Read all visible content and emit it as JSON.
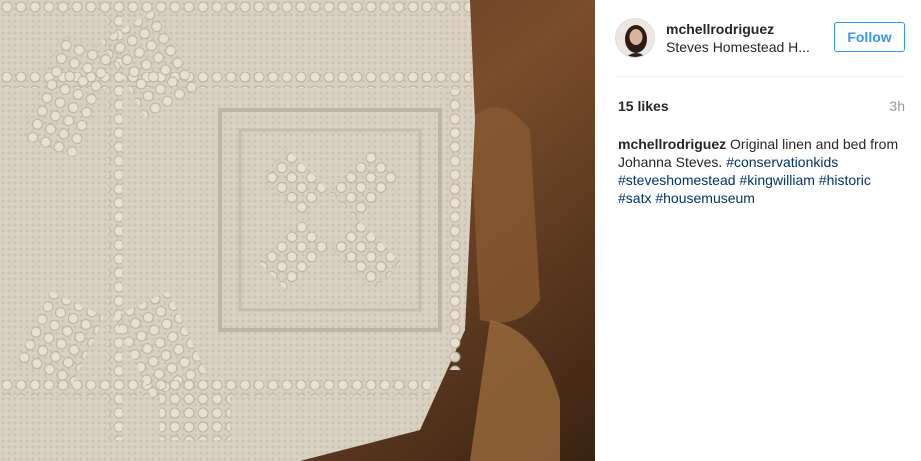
{
  "post": {
    "username": "mchellrodriguez",
    "location": "Steves Homestead H...",
    "follow_label": "Follow",
    "likes": "15 likes",
    "time": "3h",
    "caption": {
      "username": "mchellrodriguez",
      "text": "Original linen and bed from Johanna Steves.",
      "hashtags": [
        "#conservationkids",
        "#steveshomestead",
        "#kingwilliam",
        "#historic",
        "#satx",
        "#housemuseum"
      ]
    }
  },
  "colors": {
    "link": "#003569",
    "follow": "#3897f0",
    "muted": "#999999"
  }
}
